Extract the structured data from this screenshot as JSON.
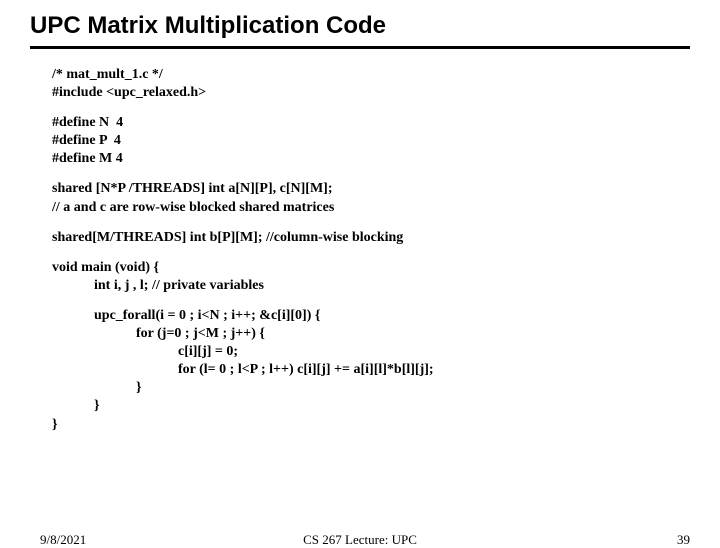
{
  "title": "UPC Matrix Multiplication Code",
  "code": {
    "l1": "/* mat_mult_1.c */",
    "l2": "#include <upc_relaxed.h>",
    "l3": "#define N  4",
    "l4": "#define P  4",
    "l5": "#define M 4",
    "l6": "shared [N*P /THREADS] int a[N][P], c[N][M];",
    "l7": "// a and c are row-wise blocked shared matrices",
    "l8": "shared[M/THREADS] int b[P][M]; //column-wise blocking",
    "l9": "void main (void) {",
    "l10": "            int i, j , l; // private variables",
    "l11": "            upc_forall(i = 0 ; i<N ; i++; &c[i][0]) {",
    "l12": "                        for (j=0 ; j<M ; j++) {",
    "l13": "                                    c[i][j] = 0;",
    "l14": "                                    for (l= 0 ; l<P ; l++) c[i][j] += a[i][l]*b[l][j];",
    "l15": "                        }",
    "l16": "            }",
    "l17": "}"
  },
  "footer": {
    "date": "9/8/2021",
    "mid": "CS 267 Lecture: UPC",
    "page": "39"
  }
}
